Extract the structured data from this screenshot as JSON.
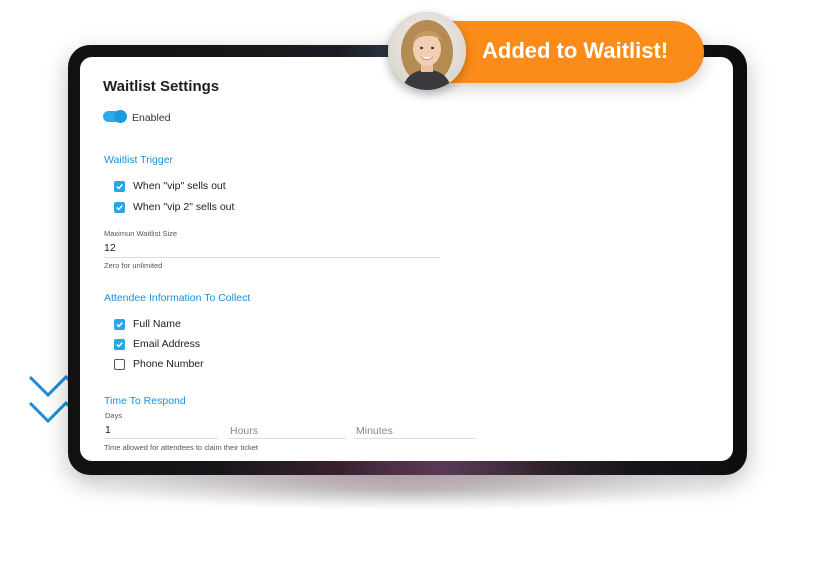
{
  "settings": {
    "title": "Waitlist Settings",
    "toggle_label": "Enabled",
    "toggle_on": true,
    "trigger_section": "Waitlist Trigger",
    "triggers": [
      {
        "label": "When \"vip\" sells out",
        "checked": true
      },
      {
        "label": "When \"vip 2\" sells out",
        "checked": true
      }
    ],
    "max_size_label": "Maximun Waitlist Size",
    "max_size_value": "12",
    "max_size_help": "Zero for unlimited",
    "attendee_section": "Attendee Information To Collect",
    "attendee_fields": [
      {
        "label": "Full Name",
        "checked": true
      },
      {
        "label": "Email Address",
        "checked": true
      },
      {
        "label": "Phone Number",
        "checked": false
      }
    ],
    "respond_section": "Time To Respond",
    "days_label": "Days",
    "days_value": "1",
    "hours_placeholder": "Hours",
    "minutes_placeholder": "Minutes",
    "respond_help": "Time allowed for attendees to claim their ticket"
  },
  "badge": {
    "text": "Added to Waitlist!",
    "color": "#fb8c1a"
  },
  "colors": {
    "accent": "#1a8fd6",
    "checkbox": "#29a6e6"
  }
}
